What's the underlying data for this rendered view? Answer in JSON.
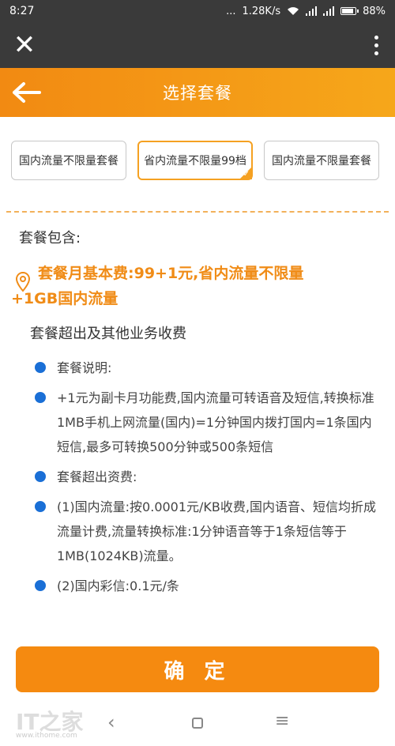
{
  "status_bar": {
    "time": "8:27",
    "dots": "...",
    "network_speed": "1.28K/s",
    "battery": "88%",
    "battery_level": 0.88
  },
  "web_bar": {
    "close_icon": "close-icon",
    "more_icon": "more-vertical-icon"
  },
  "header": {
    "title": "选择套餐",
    "back_icon": "back-arrow-icon",
    "accent": "#f28a12"
  },
  "plans": [
    {
      "label": "国内流量不限量套餐",
      "selected": false
    },
    {
      "label": "省内流量不限量99档",
      "selected": true
    },
    {
      "label": "国内流量不限量套餐",
      "selected": false
    }
  ],
  "package": {
    "section_title": "套餐包含:",
    "highlight_line1": "套餐月基本费:99+1元,省内流量不限量",
    "highlight_line2": "+1GB国内流量",
    "sub_title": "套餐超出及其他业务收费",
    "items": [
      "套餐说明:",
      "+1元为副卡月功能费,国内流量可转语音及短信,转换标准1MB手机上网流量(国内)=1分钟国内拨打国内=1条国内短信,最多可转换500分钟或500条短信",
      "套餐超出资费:",
      "(1)国内流量:按0.0001元/KB收费,国内语音、短信均折成流量计费,流量转换标准:1分钟语音等于1条短信等于1MB(1024KB)流量。",
      "(2)国内彩信:0.1元/条"
    ]
  },
  "confirm_button": "确 定",
  "nav_bar": {
    "watermark": "IT之家",
    "watermark_sub": "www.ithome.com"
  },
  "colors": {
    "orange": "#f58a10",
    "bullet_blue": "#1a6fd6",
    "dark_bar": "#3a3a3a"
  }
}
